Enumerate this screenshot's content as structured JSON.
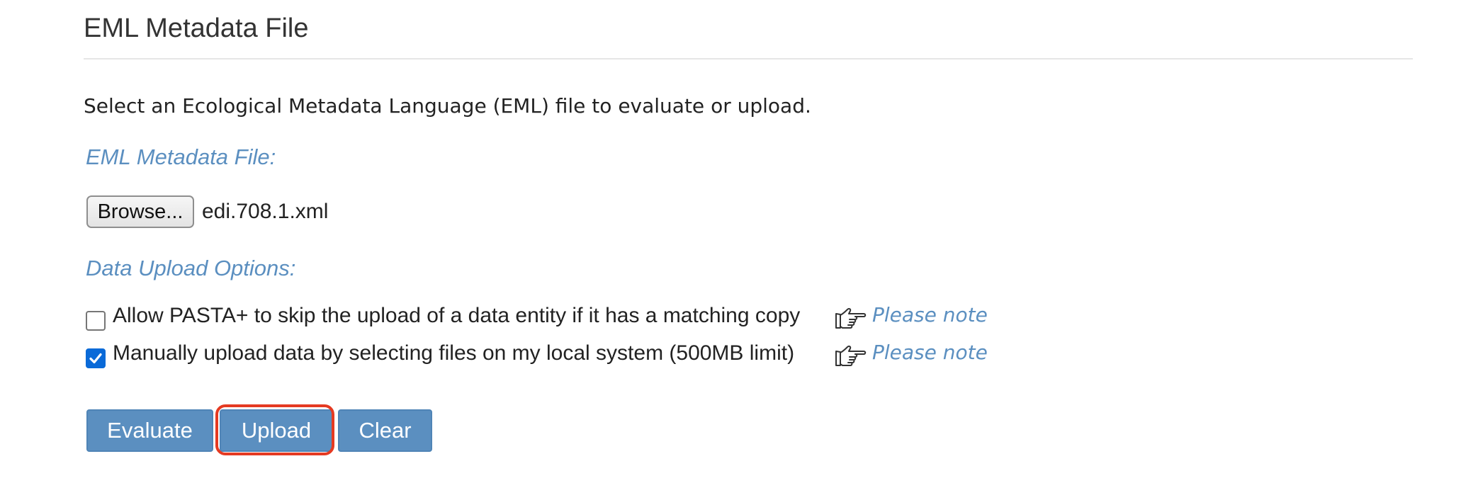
{
  "page": {
    "title": "EML Metadata File",
    "intro": "Select an Ecological Metadata Language (EML) file to evaluate or upload."
  },
  "file_section": {
    "label": "EML Metadata File:",
    "browse_label": "Browse...",
    "selected_file": "edi.708.1.xml"
  },
  "options_section": {
    "label": "Data Upload Options:",
    "options": [
      {
        "text": "Allow PASTA+ to skip the upload of a data entity if it has a matching copy",
        "checked": false,
        "note_label": "Please note",
        "icon": "pointing-hand-icon"
      },
      {
        "text": "Manually upload data by selecting files on my local system (500MB limit)",
        "checked": true,
        "note_label": "Please note",
        "icon": "pointing-hand-icon"
      }
    ]
  },
  "actions": {
    "evaluate_label": "Evaluate",
    "upload_label": "Upload",
    "clear_label": "Clear",
    "highlighted": "upload"
  },
  "colors": {
    "accent": "#5b8fc0",
    "checkbox_checked": "#0a6ad8",
    "highlight_ring": "#e53a22"
  }
}
